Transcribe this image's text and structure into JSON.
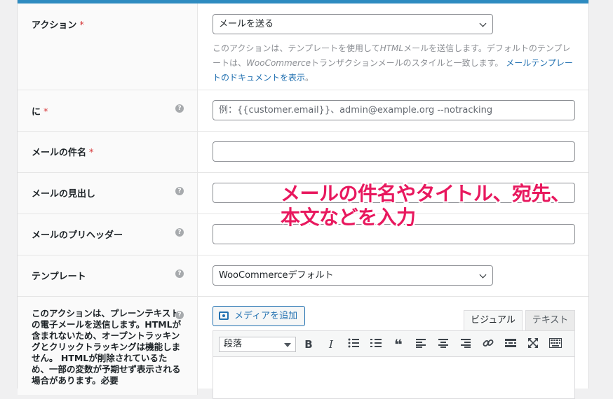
{
  "fields": {
    "action": {
      "label": "アクション",
      "required_mark": "*",
      "selected": "メールを送る",
      "desc_part1": "このアクションは、テンプレートを使用して",
      "desc_html": "HTML",
      "desc_part2": "メールを送信します。デフォルトのテンプレートは、",
      "desc_woo": "WooCommerce",
      "desc_part3": "トランザクションメールのスタイルと一致します。 ",
      "desc_link": "メールテンプレートのドキュメントを表示",
      "desc_end": "。"
    },
    "to": {
      "label": "に",
      "required_mark": "*",
      "placeholder": "例：{{customer.email}}、admin@example.org --notracking"
    },
    "subject": {
      "label": "メールの件名",
      "required_mark": "*"
    },
    "heading": {
      "label": "メールの見出し"
    },
    "preheader": {
      "label": "メールのプリヘッダー"
    },
    "template": {
      "label": "テンプレート",
      "selected": "WooCommerceデフォルト"
    },
    "content": {
      "description": "このアクションは、プレーンテキストの電子メールを送信します。HTMLが含まれないため、オープントラッキングとクリックトラッキングは機能しません。 HTMLが削除されているため、一部の変数が予期せず表示される場合があります。必要"
    }
  },
  "help_icon": "?",
  "editor": {
    "add_media_label": "メディアを追加",
    "tab_visual": "ビジュアル",
    "tab_text": "テキスト",
    "format_select": "段落",
    "toolbar_icons": [
      "bold-icon",
      "italic-icon",
      "bullet-list-icon",
      "numbered-list-icon",
      "blockquote-icon",
      "align-left-icon",
      "align-center-icon",
      "align-right-icon",
      "link-icon",
      "read-more-icon",
      "fullscreen-icon",
      "toolbar-toggle-icon"
    ],
    "bold_glyph": "B",
    "italic_glyph": "I",
    "quote_glyph": "❝"
  },
  "annotation": {
    "line1": "メールの件名やタイトル、宛先、",
    "line2": "本文などを入力"
  },
  "colors": {
    "accent_bar": "#2e8bc0",
    "required": "#d63638",
    "link": "#2271b1",
    "annotation": "#e8185e"
  }
}
